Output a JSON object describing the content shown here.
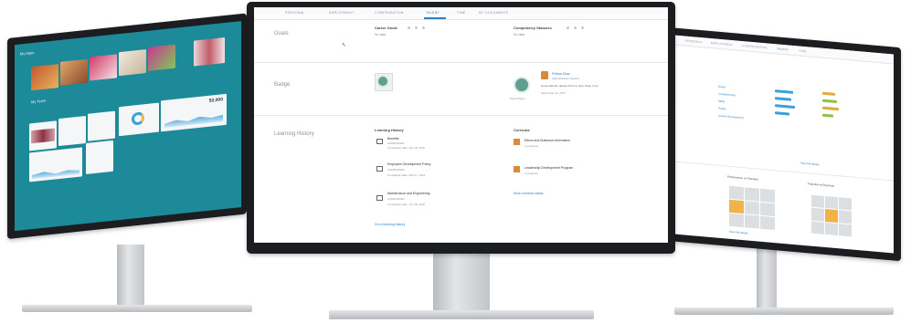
{
  "center": {
    "tabs": [
      {
        "label": "PERSONAL",
        "active": false
      },
      {
        "label": "EMPLOYMENT",
        "active": false
      },
      {
        "label": "COMPENSATION",
        "active": false
      },
      {
        "label": "TALENT",
        "active": true
      },
      {
        "label": "TIME",
        "active": false
      },
      {
        "label": "MY DOCUMENTS",
        "active": false
      }
    ],
    "sections": {
      "goals": {
        "label": "Goals",
        "col1_title": "Career Goals",
        "col1_text": "No data",
        "col2_title": "Competency Statuses",
        "col2_text": "No data"
      },
      "badge": {
        "label": "Badge",
        "person_name": "Felisa Diaz",
        "person_title": "Administrative Support",
        "message": "Great attitude, always there to help. Keep it up!",
        "date": "September 11, 2017",
        "badge_caption": "Team Player"
      },
      "learning": {
        "label": "Learning History",
        "col1_title": "Learning History",
        "items": [
          {
            "title": "Benefits",
            "sub": "COMPLETED",
            "detail": "Completion date: Jan 18, 2016"
          },
          {
            "title": "Employee Development Policy",
            "sub": "COMPLETED",
            "detail": "Completion date: Mar 07, 2016"
          },
          {
            "title": "Maintenance and Engineering",
            "sub": "COMPLETED",
            "detail": "Completion date: Jun 08, 2016"
          }
        ],
        "more_link": "Go to learning history",
        "col2_title": "Curricula",
        "curricula": [
          {
            "title": "Ethics and Business Information",
            "sub": "In progress"
          },
          {
            "title": "Leadership Development Program",
            "sub": "In progress"
          }
        ],
        "curricula_link": "More curricula status"
      }
    }
  },
  "left": {
    "section1": "My Apps",
    "section2": "My Team",
    "kpi": "52,000",
    "colors": {
      "background": "#1c8a98",
      "accent": "#3aa0d8"
    }
  },
  "right": {
    "tabs": [
      "PERSONAL",
      "EMPLOYMENT",
      "COMPENSATION",
      "TALENT",
      "TIME"
    ],
    "left_items": [
      "Goals",
      "Competencies",
      "Skills",
      "Profile",
      "Career Development"
    ],
    "grid1_title": "Performance vs Potential",
    "grid2_title": "Potential vs Retention",
    "footer1": "View full details",
    "footer2": "View full details"
  }
}
